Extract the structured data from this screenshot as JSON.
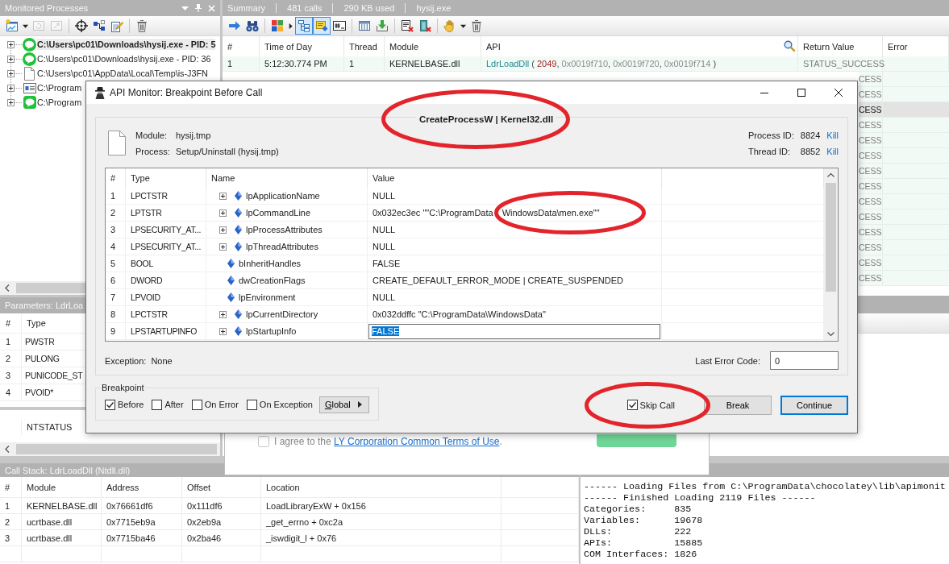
{
  "monitored_processes": {
    "title": "Monitored Processes",
    "toolbar": [
      {
        "items": [
          {
            "kind": "chart-window",
            "disabled": false
          },
          {
            "kind": "caret-down",
            "disabled": false
          },
          {
            "kind": "refresh",
            "disabled": true
          },
          {
            "kind": "chart-export",
            "disabled": true
          }
        ]
      },
      {
        "items": [
          {
            "kind": "crosshair",
            "disabled": false
          },
          {
            "kind": "blocks",
            "disabled": false
          },
          {
            "kind": "notepad",
            "disabled": false
          }
        ]
      },
      {
        "items": [
          {
            "kind": "trash",
            "disabled": false
          }
        ]
      }
    ],
    "processes": [
      {
        "path": "C:\\Users\\pc01\\Downloads\\hysij.exe - PID: 5",
        "kind": "bubble",
        "expanded": false,
        "selected": true
      },
      {
        "path": "C:\\Users\\pc01\\Downloads\\hysij.exe - PID: 36",
        "kind": "bubble",
        "expanded": false,
        "selected": false
      },
      {
        "path": "C:\\Users\\pc01\\AppData\\Local\\Temp\\is-J3FN",
        "kind": "file",
        "expanded": false,
        "selected": false
      },
      {
        "path": "C:\\Program",
        "kind": "window",
        "expanded": false,
        "selected": false
      },
      {
        "path": "C:\\Program",
        "kind": "chat",
        "expanded": false,
        "selected": false
      }
    ]
  },
  "parameters_panel": {
    "title": "Parameters: LdrLoa",
    "columns": [
      "#",
      "Type"
    ],
    "rows": [
      {
        "number": "1",
        "type": "PWSTR"
      },
      {
        "number": "2",
        "type": "PULONG"
      },
      {
        "number": "3",
        "type": "PUNICODE_ST"
      },
      {
        "number": "4",
        "type": "PVOID*"
      }
    ],
    "return_type": "NTSTATUS"
  },
  "summary": {
    "title_items": [
      "Summary",
      "481 calls",
      "290 KB used",
      "hysij.exe"
    ],
    "toolbar": [
      {
        "items": [
          {
            "kind": "go",
            "pressed": false
          },
          {
            "kind": "find",
            "pressed": false
          }
        ]
      },
      {
        "items": [
          {
            "kind": "colors",
            "pressed": false
          },
          {
            "kind": "caret-right",
            "pressed": false
          },
          {
            "kind": "tree",
            "pressed": true
          },
          {
            "kind": "note",
            "pressed": true
          },
          {
            "kind": "hash",
            "pressed": false
          }
        ]
      },
      {
        "items": [
          {
            "kind": "columns",
            "pressed": false
          },
          {
            "kind": "import",
            "pressed": false
          }
        ]
      },
      {
        "items": [
          {
            "kind": "doc-x",
            "pressed": false
          },
          {
            "kind": "door-x",
            "pressed": false
          }
        ]
      },
      {
        "items": [
          {
            "kind": "hand",
            "pressed": false
          },
          {
            "kind": "caret-down",
            "pressed": false
          },
          {
            "kind": "trash",
            "pressed": false
          }
        ]
      }
    ],
    "columns": [
      {
        "label": "#",
        "filter": false
      },
      {
        "label": "Time of Day",
        "filter": false
      },
      {
        "label": "Thread",
        "filter": false
      },
      {
        "label": "Module",
        "filter": false
      },
      {
        "label": "API",
        "filter": true
      },
      {
        "label": "Return Value",
        "filter": false
      },
      {
        "label": "Error",
        "filter": false
      }
    ],
    "rows": [
      {
        "number": "1",
        "time": "5:12:30.774 PM",
        "thread": "1",
        "module": "KERNELBASE.dll",
        "api": [
          {
            "kind": "function",
            "text": "LdrLoadDll"
          },
          {
            "kind": "punctuation",
            "text": " ( "
          },
          {
            "kind": "number",
            "text": "2049"
          },
          {
            "kind": "punctuation",
            "text": ", "
          },
          {
            "kind": "pointer",
            "text": "0x0019f710"
          },
          {
            "kind": "punctuation",
            "text": ", "
          },
          {
            "kind": "pointer",
            "text": "0x0019f720"
          },
          {
            "kind": "punctuation",
            "text": ", "
          },
          {
            "kind": "pointer",
            "text": "0x0019f714"
          },
          {
            "kind": "punctuation",
            "text": " )"
          }
        ],
        "return_value": "STATUS_SUCCESS",
        "selected": false
      }
    ],
    "rows_behind_dialog": [
      {
        "return_value": "CESS",
        "selected": false
      },
      {
        "return_value": "CESS",
        "selected": false
      },
      {
        "return_value": "CESS",
        "selected": true
      },
      {
        "return_value": "CESS",
        "selected": false
      },
      {
        "return_value": "CESS",
        "selected": false
      },
      {
        "return_value": "CESS",
        "selected": false
      },
      {
        "return_value": "CESS",
        "selected": false
      },
      {
        "return_value": "CESS",
        "selected": false
      },
      {
        "return_value": "CESS",
        "selected": false
      },
      {
        "return_value": "CESS",
        "selected": false
      },
      {
        "return_value": "CESS",
        "selected": false
      },
      {
        "return_value": "CESS",
        "selected": false
      },
      {
        "return_value": "CESS",
        "selected": false
      },
      {
        "return_value": "CESS",
        "selected": false
      }
    ]
  },
  "call_stack": {
    "title": "Call Stack: LdrLoadDll (Ntdll.dll)",
    "columns": [
      "#",
      "Module",
      "Address",
      "Offset",
      "Location"
    ],
    "rows": [
      {
        "number": "1",
        "module": "KERNELBASE.dll",
        "address": "0x76661df6",
        "offset": "0x111df6",
        "location": "LoadLibraryExW + 0x156"
      },
      {
        "number": "2",
        "module": "ucrtbase.dll",
        "address": "0x7715eb9a",
        "offset": "0x2eb9a",
        "location": "_get_errno + 0xc2a"
      },
      {
        "number": "3",
        "module": "ucrtbase.dll",
        "address": "0x7715ba46",
        "offset": "0x2ba46",
        "location": "_iswdigit_l + 0x76"
      }
    ]
  },
  "output": {
    "lines": [
      "------ Loading Files from C:\\ProgramData\\chocolatey\\lib\\apimonit",
      "------ Finished Loading 2119 Files ------",
      "Categories:     835",
      "Variables:      19678",
      "DLLs:           222",
      "APIs:           15885",
      "COM Interfaces: 1826"
    ]
  },
  "installer": {
    "agreement": {
      "checked": false,
      "text": "I agree to the ",
      "link": "LY Corporation Common Terms of Use",
      "end": "."
    }
  },
  "dialog": {
    "title": "API Monitor: Breakpoint Before Call",
    "api_call": {
      "text": "CreateProcessW | Kernel32.dll",
      "circled": true
    },
    "module_label": "Module:",
    "module": "hysij.tmp",
    "process_label": "Process:",
    "process": "Setup/Uninstall (hysij.tmp)",
    "ids": [
      {
        "label": "Process ID:",
        "value": "8824",
        "action": "Kill"
      },
      {
        "label": "Thread ID:",
        "value": "8852",
        "action": "Kill"
      }
    ],
    "parameters": {
      "columns": [
        "#",
        "Type",
        "Name",
        "Value"
      ],
      "rows": [
        {
          "number": "1",
          "type": "LPCTSTR",
          "kind": "struct",
          "expanded": false,
          "name": "lpApplicationName",
          "value": "NULL",
          "editing": false
        },
        {
          "number": "2",
          "type": "LPTSTR",
          "kind": "struct",
          "expanded": false,
          "name": "lpCommandLine",
          "value": "0x032ec3ec \"\"C:\\ProgramData",
          "ringed_value": "WindowsData\\men.exe\"\"",
          "editing": false
        },
        {
          "number": "3",
          "type": "LPSECURITY_AT...",
          "kind": "struct",
          "expanded": false,
          "name": "lpProcessAttributes",
          "value": "NULL",
          "editing": false
        },
        {
          "number": "4",
          "type": "LPSECURITY_AT...",
          "kind": "struct",
          "expanded": false,
          "name": "lpThreadAttributes",
          "value": "NULL",
          "editing": false
        },
        {
          "number": "5",
          "type": "BOOL",
          "kind": "plain",
          "name": "bInheritHandles",
          "value": "FALSE",
          "editing": false
        },
        {
          "number": "6",
          "type": "DWORD",
          "kind": "plain",
          "name": "dwCreationFlags",
          "value": "CREATE_DEFAULT_ERROR_MODE | CREATE_SUSPENDED",
          "editing": false
        },
        {
          "number": "7",
          "type": "LPVOID",
          "kind": "plain",
          "name": "lpEnvironment",
          "value": "NULL",
          "editing": false
        },
        {
          "number": "8",
          "type": "LPCTSTR",
          "kind": "struct",
          "expanded": false,
          "name": "lpCurrentDirectory",
          "value": "0x032ddffc \"C:\\ProgramData\\WindowsData\"",
          "editing": false
        },
        {
          "number": "9",
          "type": "LPSTARTUPINFO",
          "kind": "struct",
          "expanded": false,
          "name": "lpStartupInfo",
          "value": "FALSE",
          "editing": true
        }
      ]
    },
    "exception_label": "Exception:",
    "exception": "None",
    "last_error_label": "Last Error Code:",
    "last_error": "0",
    "breakpoint": {
      "title": "Breakpoint",
      "options": [
        {
          "label": "Before",
          "checked": true
        },
        {
          "label": "After",
          "checked": false
        },
        {
          "label": "On Error",
          "checked": false
        },
        {
          "label": "On Exception",
          "checked": false
        }
      ],
      "scope": "Global"
    },
    "skip_call": {
      "label": "Skip Call",
      "checked": true,
      "circled": true
    },
    "buttons": [
      {
        "label": "Break",
        "default": false
      },
      {
        "label": "Continue",
        "default": true
      }
    ]
  }
}
